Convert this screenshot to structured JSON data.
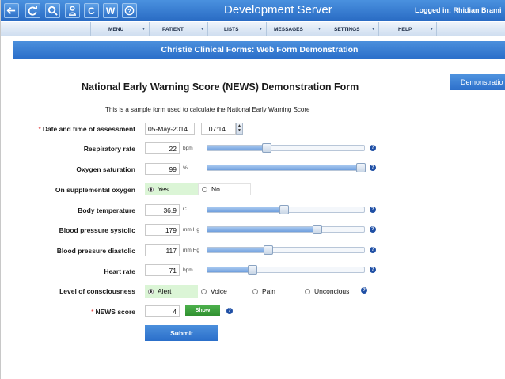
{
  "toolbar": {
    "buttons": [
      {
        "name": "back-icon",
        "glyph": ""
      },
      {
        "name": "refresh-icon",
        "glyph": ""
      },
      {
        "name": "search-icon",
        "glyph": ""
      },
      {
        "name": "patient-icon",
        "glyph": ""
      },
      {
        "name": "c-button",
        "glyph": "C"
      },
      {
        "name": "w-button",
        "glyph": "W"
      },
      {
        "name": "help-icon",
        "glyph": ""
      }
    ],
    "server_title": "Development Server",
    "logged_in": "Logged in: Rhidian Brami"
  },
  "menu": {
    "items": [
      "MENU",
      "PATIENT",
      "LISTS",
      "MESSAGES",
      "SETTINGS",
      "HELP"
    ]
  },
  "form_bar": {
    "title": "Christie Clinical Forms: Web Form Demonstration"
  },
  "demo_button": "Demonstratio",
  "form": {
    "heading": "National Early Warning Score (NEWS) Demonstration Form",
    "subtitle": "This is a sample form used to calculate the National Early Warning Score",
    "assessment": {
      "required": "*",
      "label": "Date and time of assessment",
      "date": "05-May-2014",
      "time": "07:14"
    },
    "respiratory": {
      "label": "Respiratory rate",
      "value": "22",
      "unit": "bpm",
      "slider_fraction": 0.38
    },
    "oxygen_sat": {
      "label": "Oxygen saturation",
      "value": "99",
      "unit": "%",
      "slider_fraction": 0.98
    },
    "supplemental_oxygen": {
      "label": "On supplemental oxygen",
      "options": [
        "Yes",
        "No"
      ],
      "selected": "Yes"
    },
    "temperature": {
      "label": "Body temperature",
      "value": "36.9",
      "unit": "C",
      "slider_fraction": 0.49
    },
    "bp_systolic": {
      "label": "Blood pressure systolic",
      "value": "179",
      "unit": "mm Hg",
      "slider_fraction": 0.7
    },
    "bp_diastolic": {
      "label": "Blood pressure diastolic",
      "value": "117",
      "unit": "mm Hg",
      "slider_fraction": 0.39
    },
    "heart_rate": {
      "label": "Heart rate",
      "value": "71",
      "unit": "bpm",
      "slider_fraction": 0.29
    },
    "consciousness": {
      "label": "Level of consciousness",
      "options": [
        "Alert",
        "Voice",
        "Pain",
        "Unconcious"
      ],
      "selected": "Alert"
    },
    "news_score": {
      "required": "*",
      "label": "NEWS score",
      "value": "4",
      "show_label": "Show"
    },
    "submit_label": "Submit",
    "help_glyph": "?"
  },
  "colors": {
    "primary_blue": "#2b6fca",
    "selected_green": "#dbf5d6",
    "show_button_green": "#2e8e2e",
    "required_red": "#d22"
  }
}
